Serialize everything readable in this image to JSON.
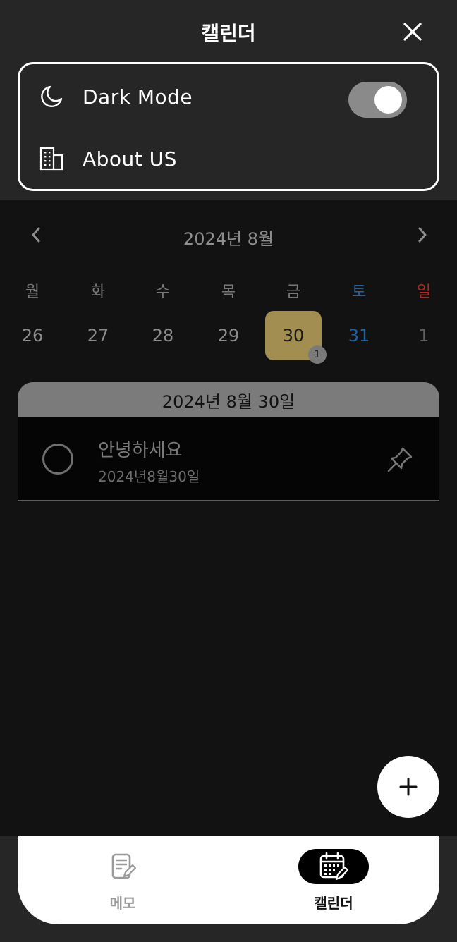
{
  "header": {
    "title": "캘린더"
  },
  "settings": {
    "dark_mode_label": "Dark Mode",
    "dark_mode_on": true,
    "about_label": "About US"
  },
  "calendar": {
    "month_title": "2024년 8월",
    "weekdays": [
      "월",
      "화",
      "수",
      "목",
      "금",
      "토",
      "일"
    ],
    "days": [
      "26",
      "27",
      "28",
      "29",
      "30",
      "31",
      "1"
    ],
    "selected_day": "30",
    "selected_count": "1",
    "selected_date_title": "2024년 8월 30일"
  },
  "memo": {
    "title": "안녕하세요",
    "date": "2024년8월30일"
  },
  "bottom_nav": {
    "memo_label": "메모",
    "calendar_label": "캘린더"
  },
  "colors": {
    "saturday": "#1d63a3",
    "sunday": "#b2291f",
    "selected_day_bg": "#a38e52"
  }
}
